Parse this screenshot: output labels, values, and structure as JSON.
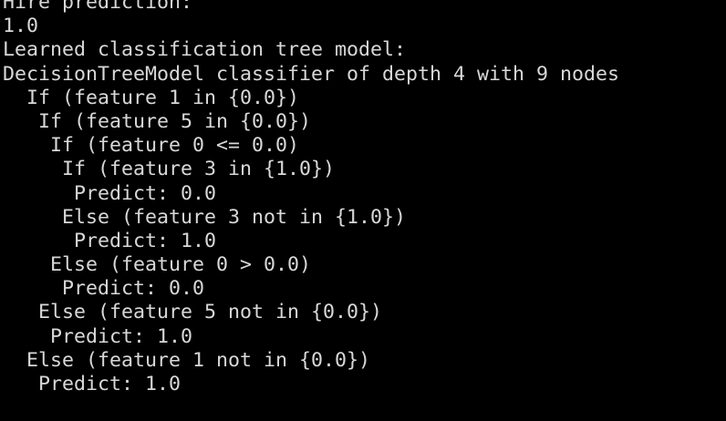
{
  "terminal": {
    "text_color": "#d8d8d8",
    "background_color": "#000000",
    "lines": [
      "Hire prediction:",
      "1.0",
      "Learned classification tree model:",
      "DecisionTreeModel classifier of depth 4 with 9 nodes",
      "  If (feature 1 in {0.0})",
      "   If (feature 5 in {0.0})",
      "    If (feature 0 <= 0.0)",
      "     If (feature 3 in {1.0})",
      "      Predict: 0.0",
      "     Else (feature 3 not in {1.0})",
      "      Predict: 1.0",
      "    Else (feature 0 > 0.0)",
      "     Predict: 0.0",
      "   Else (feature 5 not in {0.0})",
      "    Predict: 1.0",
      "  Else (feature 1 not in {0.0})",
      "   Predict: 1.0"
    ]
  }
}
